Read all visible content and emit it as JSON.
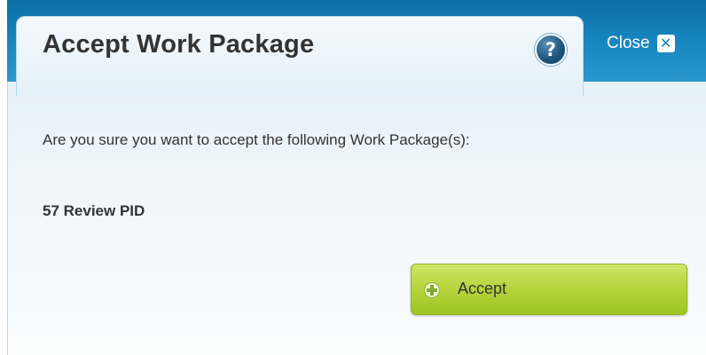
{
  "dialog": {
    "title": "Accept Work Package",
    "help_icon": "help-icon",
    "help_glyph": "?",
    "close_label": "Close",
    "close_icon": "close-icon",
    "close_glyph": "✕"
  },
  "body": {
    "message": "Are you sure you want to accept the following Work Package(s):",
    "packages": [
      "57 Review PID"
    ]
  },
  "actions": {
    "accept_label": "Accept",
    "accept_icon": "plus-icon"
  },
  "colors": {
    "header_blue": "#1684bd",
    "button_green": "#b6d63f",
    "text": "#333333"
  }
}
